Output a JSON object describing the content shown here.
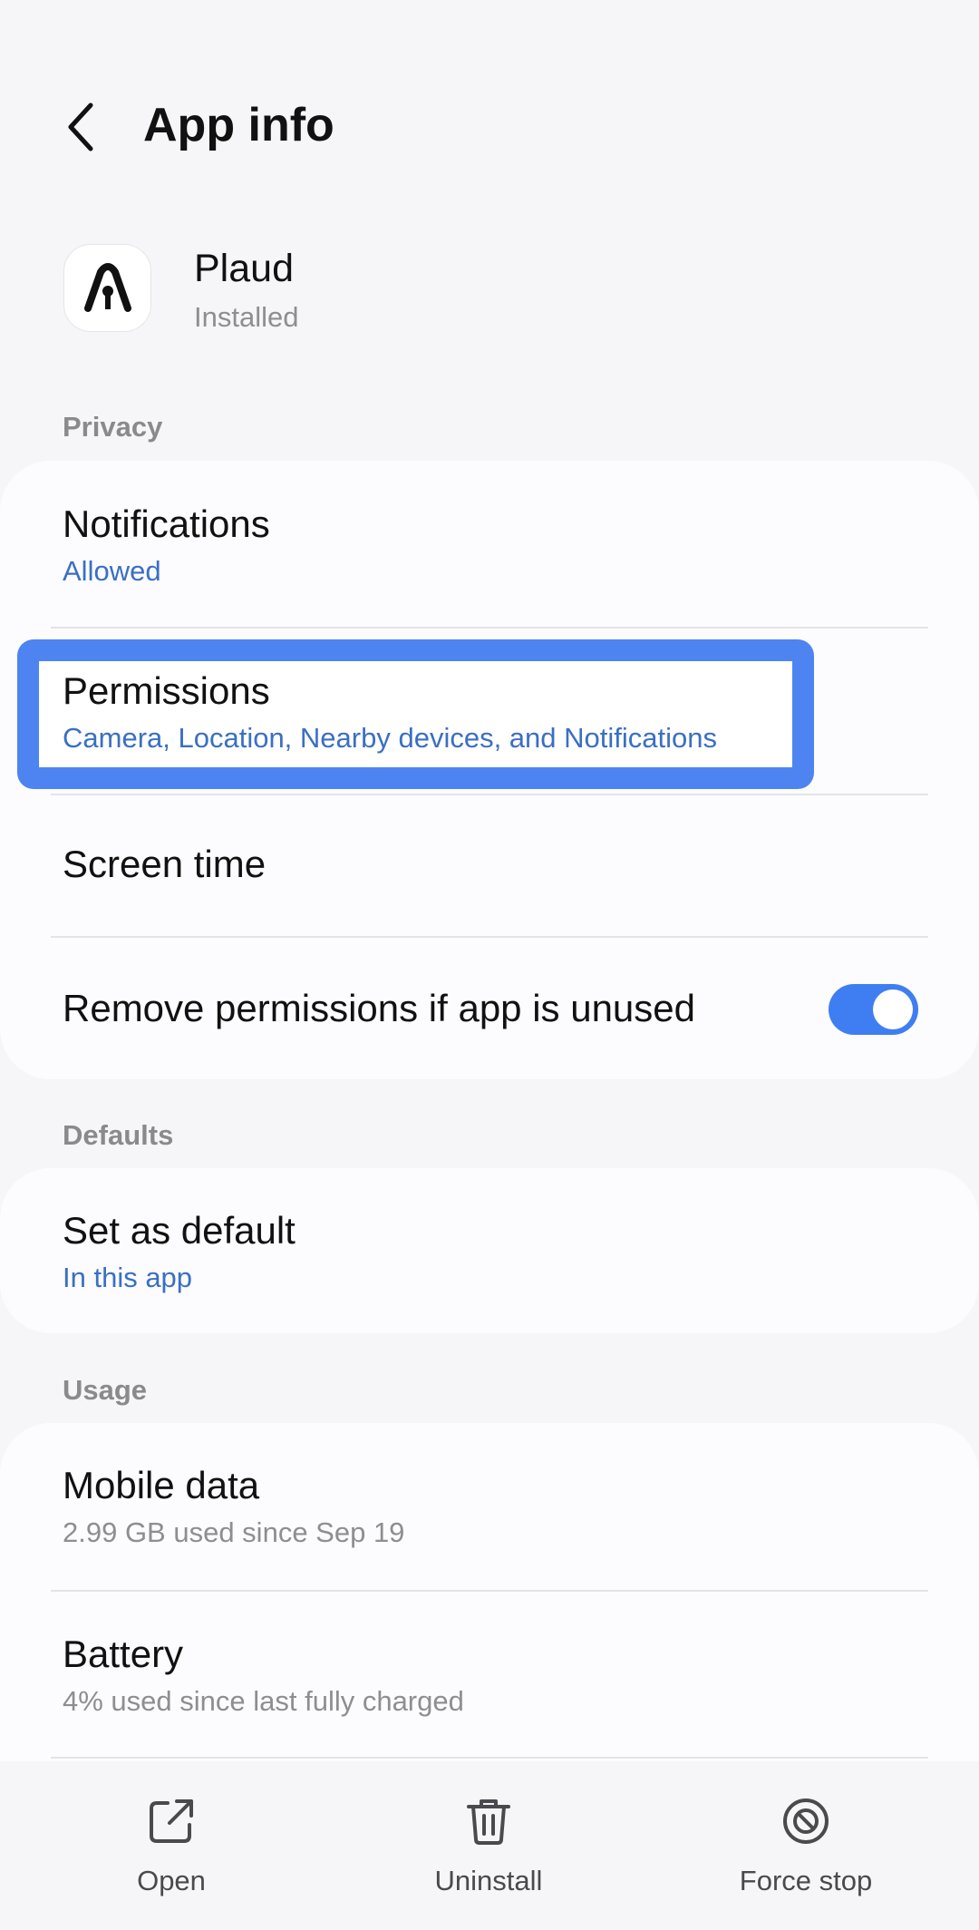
{
  "header": {
    "title": "App info",
    "back_icon": "chevron-left-icon"
  },
  "app": {
    "name": "Plaud",
    "status": "Installed",
    "icon": "plaud-logo"
  },
  "sections": {
    "privacy": {
      "label": "Privacy",
      "items": [
        {
          "title": "Notifications",
          "subtitle": "Allowed"
        },
        {
          "title": "Permissions",
          "subtitle": "Camera, Location, Nearby devices, and Notifications"
        },
        {
          "title": "Screen time"
        },
        {
          "title": "Remove permissions if app is unused",
          "toggle_on": true
        }
      ]
    },
    "defaults": {
      "label": "Defaults",
      "items": [
        {
          "title": "Set as default",
          "subtitle": "In this app"
        }
      ]
    },
    "usage": {
      "label": "Usage",
      "items": [
        {
          "title": "Mobile data",
          "subtitle": "2.99 GB used since Sep 19"
        },
        {
          "title": "Battery",
          "subtitle": "4% used since last fully charged"
        }
      ]
    }
  },
  "bottom_actions": [
    {
      "label": "Open",
      "icon": "open-external-icon"
    },
    {
      "label": "Uninstall",
      "icon": "trash-icon"
    },
    {
      "label": "Force stop",
      "icon": "block-icon"
    }
  ],
  "colors": {
    "accent": "#3f7ef2",
    "highlight": "#4d84f2",
    "link": "#3a6fc4",
    "background": "#f6f6f8"
  }
}
